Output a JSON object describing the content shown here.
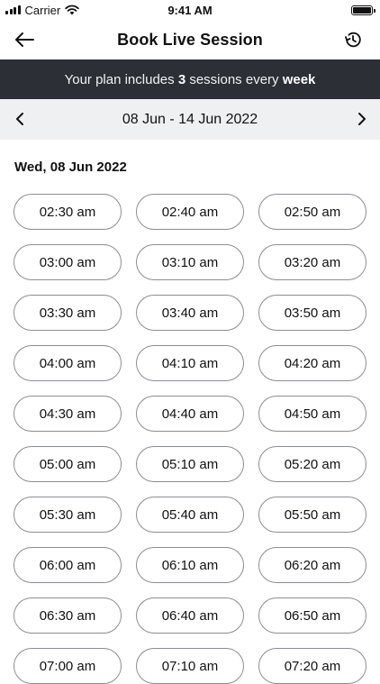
{
  "status_bar": {
    "carrier": "Carrier",
    "time": "9:41 AM"
  },
  "nav": {
    "title": "Book Live Session",
    "back_icon": "arrow-left-icon",
    "history_icon": "history-clock-icon"
  },
  "plan_banner": {
    "prefix": "Your plan includes ",
    "count": "3",
    "middle": " sessions every ",
    "period": "week"
  },
  "week": {
    "range": "08 Jun - 14 Jun 2022",
    "prev_icon": "chevron-left-icon",
    "next_icon": "chevron-right-icon"
  },
  "date_heading": "Wed, 08 Jun 2022",
  "slots": [
    "02:30 am",
    "02:40 am",
    "02:50 am",
    "03:00 am",
    "03:10 am",
    "03:20 am",
    "03:30 am",
    "03:40 am",
    "03:50 am",
    "04:00 am",
    "04:10 am",
    "04:20 am",
    "04:30 am",
    "04:40 am",
    "04:50 am",
    "05:00 am",
    "05:10 am",
    "05:20 am",
    "05:30 am",
    "05:40 am",
    "05:50 am",
    "06:00 am",
    "06:10 am",
    "06:20 am",
    "06:30 am",
    "06:40 am",
    "06:50 am",
    "07:00 am",
    "07:10 am",
    "07:20 am"
  ],
  "colors": {
    "banner_bg": "#2c2f36",
    "week_bar_bg": "#eef0f2",
    "slot_border": "#8a8d93"
  }
}
